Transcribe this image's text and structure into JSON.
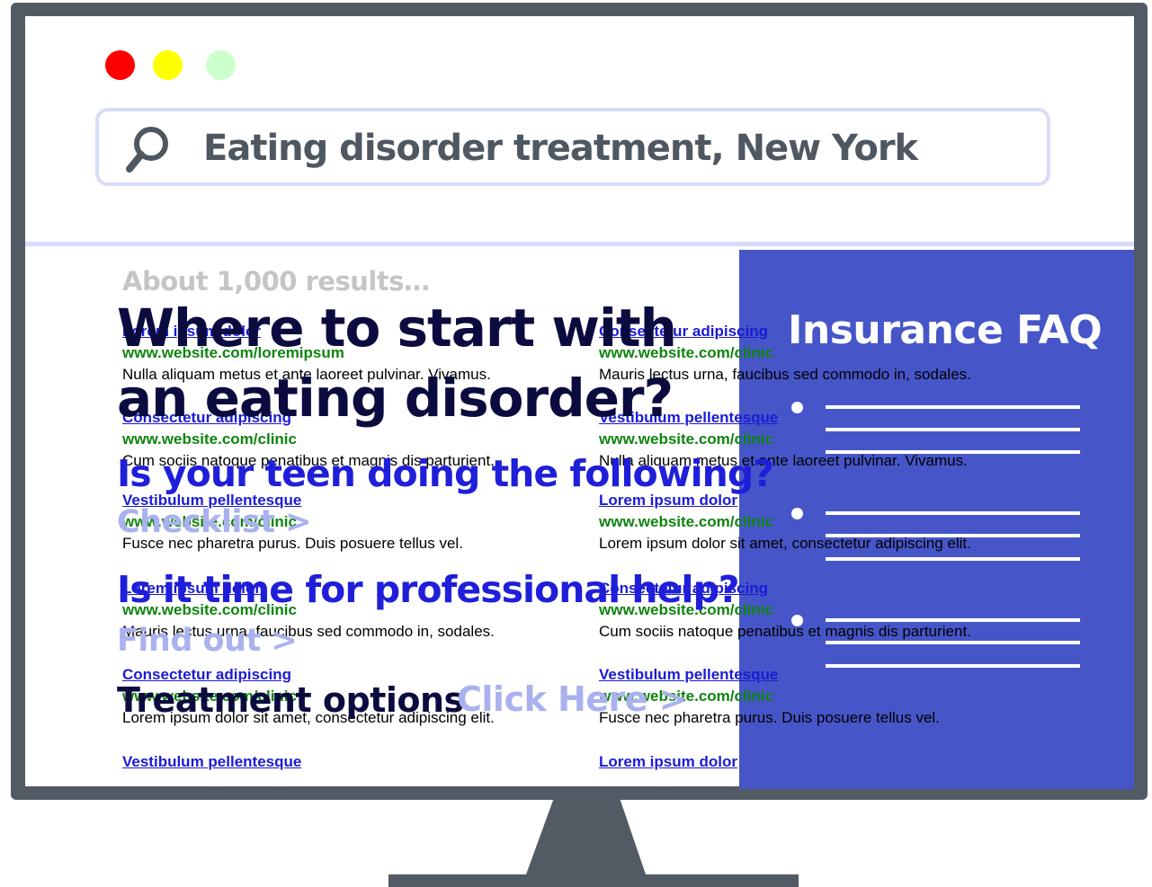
{
  "window_controls": {
    "colors": [
      "#ff0000",
      "#ffff00",
      "#ccffcc"
    ]
  },
  "search": {
    "query": "Eating disorder treatment, New York",
    "icon": "search-icon"
  },
  "results_count": "About 1,000 results…",
  "left_results": [
    {
      "title": "Lorem ipsum dolor",
      "url": "www.website.com/loremipsum",
      "desc": "Nulla aliquam metus et ante laoreet pulvinar. Vivamus."
    },
    {
      "title": "Consectetur adipiscing",
      "url": "www.website.com/clinic",
      "desc": "Cum sociis natoque penatibus et magnis dis parturient."
    },
    {
      "title": "Vestibulum pellentesque",
      "url": "www.website.com/clinic",
      "desc": "Fusce nec pharetra purus. Duis posuere tellus vel."
    },
    {
      "title": "Lorem ipsum dolor",
      "url": "www.website.com/clinic",
      "desc": "Mauris lectus urna, faucibus sed commodo in, sodales."
    },
    {
      "title": "Consectetur adipiscing",
      "url": "www.website.com/clinic",
      "desc": "Lorem ipsum dolor sit amet, consectetur adipiscing elit."
    },
    {
      "title": "Vestibulum pellentesque"
    }
  ],
  "right_results": [
    {
      "title": "Consectetur adipiscing",
      "url": "www.website.com/clinic",
      "desc": "Mauris lectus urna, faucibus sed commodo in, sodales."
    },
    {
      "title": "Vestibulum pellentesque",
      "url": "www.website.com/clinic",
      "desc": "Nulla aliquam metus et ante laoreet pulvinar. Vivamus."
    },
    {
      "title": "Lorem ipsum dolor",
      "url": "www.website.com/clinic",
      "desc": "Lorem ipsum dolor sit amet, consectetur adipiscing elit."
    },
    {
      "title": "Consectetur adipiscing",
      "url": "www.website.com/clinic",
      "desc": "Cum sociis natoque penatibus et magnis dis parturient."
    },
    {
      "title": "Vestibulum pellentesque",
      "url": "www.website.com/clinic",
      "desc": "Fusce nec pharetra purus. Duis posuere tellus vel."
    },
    {
      "title": "Lorem ipsum dolor"
    }
  ],
  "faq_panel": {
    "title": "Insurance FAQ",
    "color": "#4656c8"
  },
  "overlay": {
    "headline_line1": "Where to start with",
    "headline_line2": "an eating disorder?",
    "question1": "Is your teen doing the following?",
    "cta1": "Checklist >",
    "question2": "Is it time for professional help?",
    "cta2": "Find out >",
    "treatment": "Treatment options",
    "cta3": "Click Here >"
  }
}
